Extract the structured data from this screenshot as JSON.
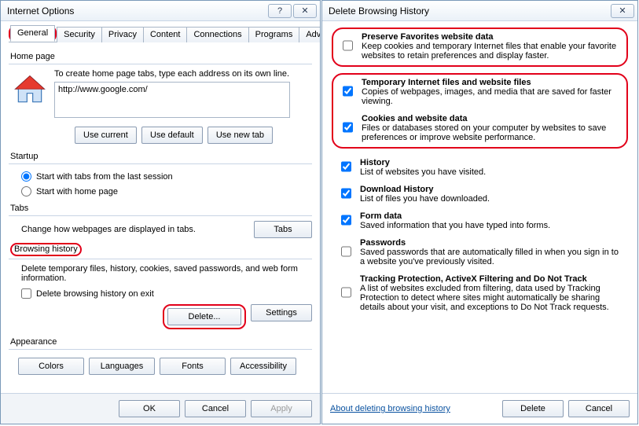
{
  "left": {
    "title": "Internet Options",
    "tabs": [
      "General",
      "Security",
      "Privacy",
      "Content",
      "Connections",
      "Programs",
      "Advanced"
    ],
    "sections": {
      "home": {
        "label": "Home page",
        "desc": "To create home page tabs, type each address on its own line.",
        "url": "http://www.google.com/",
        "btn_current": "Use current",
        "btn_default": "Use default",
        "btn_newtab": "Use new tab"
      },
      "startup": {
        "label": "Startup",
        "opt_last": "Start with tabs from the last session",
        "opt_home": "Start with home page"
      },
      "tabs": {
        "label": "Tabs",
        "desc": "Change how webpages are displayed in tabs.",
        "btn": "Tabs"
      },
      "history": {
        "label": "Browsing history",
        "desc": "Delete temporary files, history, cookies, saved passwords, and web form information.",
        "chk": "Delete browsing history on exit",
        "btn_delete": "Delete...",
        "btn_settings": "Settings"
      },
      "appearance": {
        "label": "Appearance",
        "btn_colors": "Colors",
        "btn_lang": "Languages",
        "btn_fonts": "Fonts",
        "btn_access": "Accessibility"
      }
    },
    "footer": {
      "ok": "OK",
      "cancel": "Cancel",
      "apply": "Apply"
    }
  },
  "right": {
    "title": "Delete Browsing History",
    "items": {
      "preserve": {
        "title": "Preserve Favorites website data",
        "desc": "Keep cookies and temporary Internet files that enable your favorite websites to retain preferences and display faster.",
        "checked": false
      },
      "tempfiles": {
        "title": "Temporary Internet files and website files",
        "desc": "Copies of webpages, images, and media that are saved for faster viewing.",
        "checked": true
      },
      "cookies": {
        "title": "Cookies and website data",
        "desc": "Files or databases stored on your computer by websites to save preferences or improve website performance.",
        "checked": true
      },
      "history": {
        "title": "History",
        "desc": "List of websites you have visited.",
        "checked": true
      },
      "dlhistory": {
        "title": "Download History",
        "desc": "List of files you have downloaded.",
        "checked": true
      },
      "formdata": {
        "title": "Form data",
        "desc": "Saved information that you have typed into forms.",
        "checked": true
      },
      "passwords": {
        "title": "Passwords",
        "desc": "Saved passwords that are automatically filled in when you sign in to a website you've previously visited.",
        "checked": false
      },
      "tracking": {
        "title": "Tracking Protection, ActiveX Filtering and Do Not Track",
        "desc": "A list of websites excluded from filtering, data used by Tracking Protection to detect where sites might automatically be sharing details about your visit, and exceptions to Do Not Track requests.",
        "checked": false
      }
    },
    "footer": {
      "link": "About deleting browsing history",
      "delete": "Delete",
      "cancel": "Cancel"
    }
  }
}
